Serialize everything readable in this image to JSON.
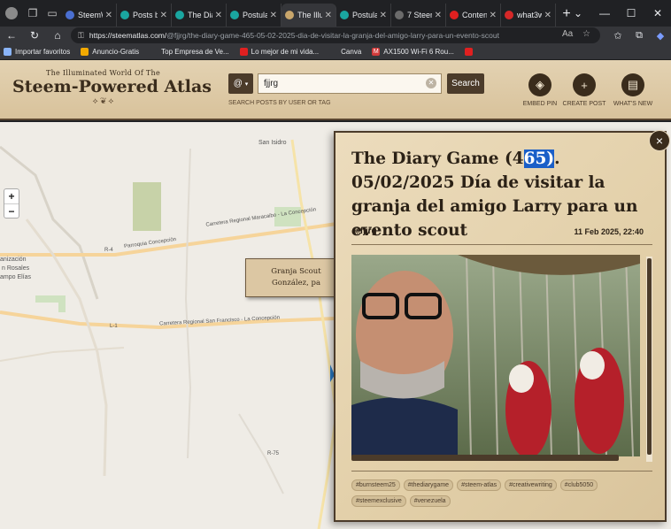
{
  "browser": {
    "tabs": [
      {
        "label": "SteemW",
        "color": "#4a6fd1"
      },
      {
        "label": "Posts by",
        "color": "#1aa6a0"
      },
      {
        "label": "The Diar",
        "color": "#1aa6a0"
      },
      {
        "label": "Postulac",
        "color": "#1aa6a0"
      },
      {
        "label": "The Illum",
        "color": "#c9a66b",
        "active": true
      },
      {
        "label": "Postulac",
        "color": "#1aa6a0"
      },
      {
        "label": "Steem Sa",
        "color": "#6b6b6b",
        "prefix": "7"
      },
      {
        "label": "Contenid",
        "color": "#e02020"
      },
      {
        "label": "what3w",
        "color": "#d62828"
      }
    ],
    "url_host": "https://steematlas.com/",
    "url_path": "@fjjrg/the-diary-game-465-05-02-2025-dia-de-visitar-la-granja-del-amigo-larry-para-un-evento-scout",
    "bookmarks": [
      {
        "label": "Importar favoritos",
        "color": "#8ab4f8"
      },
      {
        "label": "Anuncio-Gratis",
        "color": "#f2a900"
      },
      {
        "label": "Top Empresa de Ve...",
        "color": "#35363a"
      },
      {
        "label": "Lo mejor de mi vida...",
        "color": "#e02020"
      },
      {
        "label": "Canva",
        "color": "#35363a"
      },
      {
        "label": "AX1500 Wi-Fi 6 Rou...",
        "color": "#d23b3b",
        "prefix": "M"
      },
      {
        "label": "",
        "color": "#e02020"
      }
    ]
  },
  "site": {
    "logo_sub": "The Illuminated World Of The",
    "logo_main": "Steem-Powered Atlas",
    "search": {
      "prefix": "@",
      "value": "fjjrg",
      "button": "Search",
      "help": "SEARCH POSTS BY USER OR TAG"
    },
    "actions": [
      {
        "label": "EMBED PIN",
        "icon": "map-pin-icon"
      },
      {
        "label": "CREATE POST",
        "icon": "plus-icon"
      },
      {
        "label": "WHAT'S NEW",
        "icon": "news-icon"
      }
    ]
  },
  "map": {
    "zoom_in": "+",
    "zoom_out": "−",
    "labels": [
      {
        "text": "San Isidro"
      },
      {
        "text": "Carretera Regional Maracaibo - La Concepción"
      },
      {
        "text": "Parroquia Concepción"
      },
      {
        "text": "R-4"
      },
      {
        "text": "anización"
      },
      {
        "text": "n Rosales"
      },
      {
        "text": "ampo Elías"
      },
      {
        "text": "L-1"
      },
      {
        "text": "Carretera Regional San Francisco - La Concepción"
      },
      {
        "text": "R-75"
      }
    ],
    "popup_line1": "Granja Scout",
    "popup_line2": "González, pa"
  },
  "post": {
    "title_before": "The Diary Game (4",
    "title_highlight": "65)",
    "title_after": ". 05/02/2025 Día de visitar la granja del amigo Larry para un evento scout",
    "author": "@fjjrg",
    "date": "11 Feb 2025, 22:40",
    "close": "×",
    "tags": [
      "#burnsteem25",
      "#thediarygame",
      "#steem-atlas",
      "#creativewriting",
      "#club5050",
      "#steemexclusive",
      "#venezuela"
    ]
  }
}
